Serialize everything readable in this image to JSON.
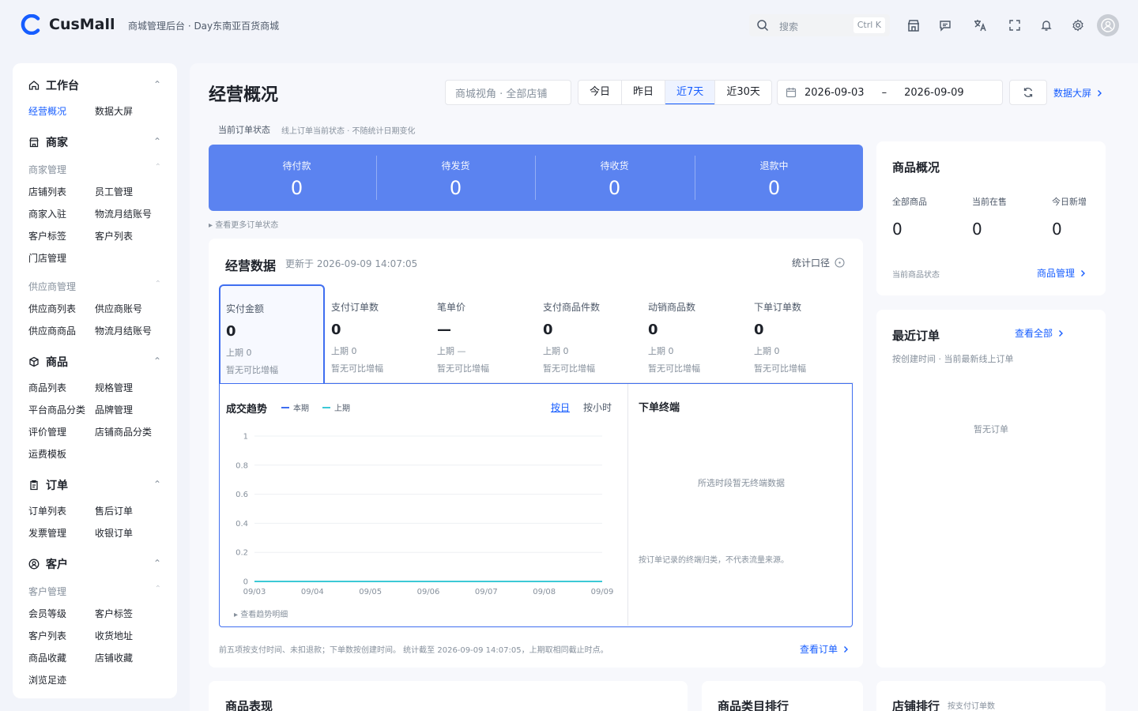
{
  "header": {
    "brand": "CusMall",
    "subtitle": "商城管理后台 · Day东南亚百货商城",
    "search_placeholder": "搜索",
    "search_shortcut": "Ctrl K"
  },
  "sidebar": {
    "groups": [
      {
        "title": "工作台",
        "items": [
          "经营概况",
          "数据大屏"
        ]
      },
      {
        "title": "商家",
        "subs": [
          {
            "label": "商家管理",
            "items": [
              "店铺列表",
              "员工管理",
              "商家入驻",
              "物流月结账号",
              "客户标签",
              "客户列表",
              "门店管理"
            ]
          },
          {
            "label": "供应商管理",
            "items": [
              "供应商列表",
              "供应商账号",
              "供应商商品",
              "物流月结账号"
            ]
          }
        ]
      },
      {
        "title": "商品",
        "items": [
          "商品列表",
          "规格管理",
          "平台商品分类",
          "品牌管理",
          "评价管理",
          "店铺商品分类",
          "运费模板"
        ]
      },
      {
        "title": "订单",
        "items": [
          "订单列表",
          "售后订单",
          "发票管理",
          "收银订单"
        ]
      },
      {
        "title": "客户",
        "subs": [
          {
            "label": "客户管理",
            "items": [
              "会员等级",
              "客户标签",
              "客户列表",
              "收货地址",
              "商品收藏",
              "店铺收藏",
              "浏览足迹"
            ]
          }
        ]
      }
    ]
  },
  "main": {
    "title": "经营概况",
    "scope_select": "商城视角 · 全部店铺",
    "ranges": [
      "今日",
      "昨日",
      "近7天",
      "近30天"
    ],
    "active_range": "近7天",
    "date_start": "2026-09-03",
    "date_sep": "–",
    "date_end": "2026-09-09",
    "big_screen_link": "数据大屏",
    "order_status_caption": "当前订单状态",
    "order_status_note": "线上订单当前状态 · 不随统计日期变化",
    "order_status": [
      {
        "label": "待付款",
        "value": "0"
      },
      {
        "label": "待发货",
        "value": "0"
      },
      {
        "label": "待收货",
        "value": "0"
      },
      {
        "label": "退款中",
        "value": "0"
      }
    ],
    "more_status": "▸ 查看更多订单状态",
    "ops": {
      "title": "经营数据",
      "updated": "更新于 2026-09-09 14:07:05",
      "caliber": "统计口径",
      "metrics": [
        {
          "label": "实付金额",
          "value": "0",
          "prev": "上期 0",
          "note": "暂无可比增幅"
        },
        {
          "label": "支付订单数",
          "value": "0",
          "prev": "上期 0",
          "note": "暂无可比增幅"
        },
        {
          "label": "笔单价",
          "value": "—",
          "prev": "上期 —",
          "note": "暂无可比增幅"
        },
        {
          "label": "支付商品件数",
          "value": "0",
          "prev": "上期 0",
          "note": "暂无可比增幅"
        },
        {
          "label": "动销商品数",
          "value": "0",
          "prev": "上期 0",
          "note": "暂无可比增幅"
        },
        {
          "label": "下单订单数",
          "value": "0",
          "prev": "上期 0",
          "note": "暂无可比增幅"
        }
      ],
      "trend": {
        "title": "成交趋势",
        "legend_current": "本期",
        "legend_prev": "上期",
        "by_day": "按日",
        "by_hour": "按小时",
        "detail_link": "▸ 查看趋势明细"
      },
      "terminal": {
        "title": "下单终端",
        "empty": "所选时段暂无终端数据",
        "note": "按订单记录的终端归类，不代表流量来源。"
      },
      "footnote": "前五项按支付时间、未扣退款；下单数按创建时间。 统计截至 2026-09-09 14:07:05，上期取相同截止时点。",
      "view_orders": "查看订单"
    },
    "bottom_cards": [
      "商品表现",
      "商品类目排行",
      "店铺排行"
    ],
    "shop_rank_note": "按支付订单数"
  },
  "right": {
    "goods": {
      "title": "商品概况",
      "stats": [
        {
          "label": "全部商品",
          "value": "0"
        },
        {
          "label": "当前在售",
          "value": "0"
        },
        {
          "label": "今日新增",
          "value": "0"
        }
      ],
      "caption": "当前商品状态",
      "link": "商品管理"
    },
    "recent": {
      "title": "最近订单",
      "link": "查看全部",
      "note": "按创建时间 · 当前最新线上订单",
      "empty": "暂无订单"
    }
  },
  "chart_data": {
    "type": "line",
    "x": [
      "09/03",
      "09/04",
      "09/05",
      "09/06",
      "09/07",
      "09/08",
      "09/09"
    ],
    "series": [
      {
        "name": "本期",
        "values": [
          0,
          0,
          0,
          0,
          0,
          0,
          0
        ]
      },
      {
        "name": "上期",
        "values": [
          0,
          0,
          0,
          0,
          0,
          0,
          0
        ]
      }
    ],
    "yticks": [
      "0",
      "0.2",
      "0.4",
      "0.6",
      "0.8",
      "1"
    ],
    "ylim": [
      0,
      1
    ],
    "grid": true,
    "colors": {
      "本期": "#3f6ef0",
      "上期": "#3cc9d6"
    }
  },
  "colors": {
    "accent": "#165dff",
    "panel": "#5b83f0"
  }
}
